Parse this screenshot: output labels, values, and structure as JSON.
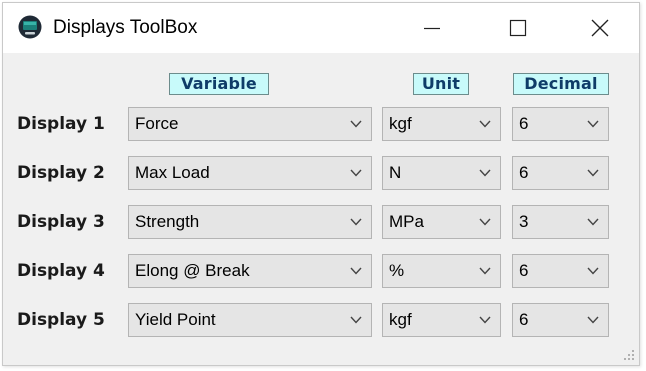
{
  "window": {
    "title": "Displays ToolBox"
  },
  "icons": {
    "app": "monitor-icon",
    "minimize": "minimize-icon",
    "maximize": "maximize-icon",
    "close": "close-icon",
    "dropdown": "chevron-down-icon"
  },
  "colors": {
    "header_bg": "#c8fafa",
    "header_text": "#0f3c68",
    "window_bg": "#f0f0f0",
    "combo_bg": "#e5e5e5"
  },
  "headers": {
    "variable": "Variable",
    "unit": "Unit",
    "decimal": "Decimal"
  },
  "rows": [
    {
      "label": "Display 1",
      "variable": "Force",
      "unit": "kgf",
      "decimal": "6"
    },
    {
      "label": "Display 2",
      "variable": "Max Load",
      "unit": "N",
      "decimal": "6"
    },
    {
      "label": "Display 3",
      "variable": "Strength",
      "unit": "MPa",
      "decimal": "3"
    },
    {
      "label": "Display 4",
      "variable": "Elong @ Break",
      "unit": "%",
      "decimal": "6"
    },
    {
      "label": "Display 5",
      "variable": "Yield Point",
      "unit": "kgf",
      "decimal": "6"
    }
  ]
}
